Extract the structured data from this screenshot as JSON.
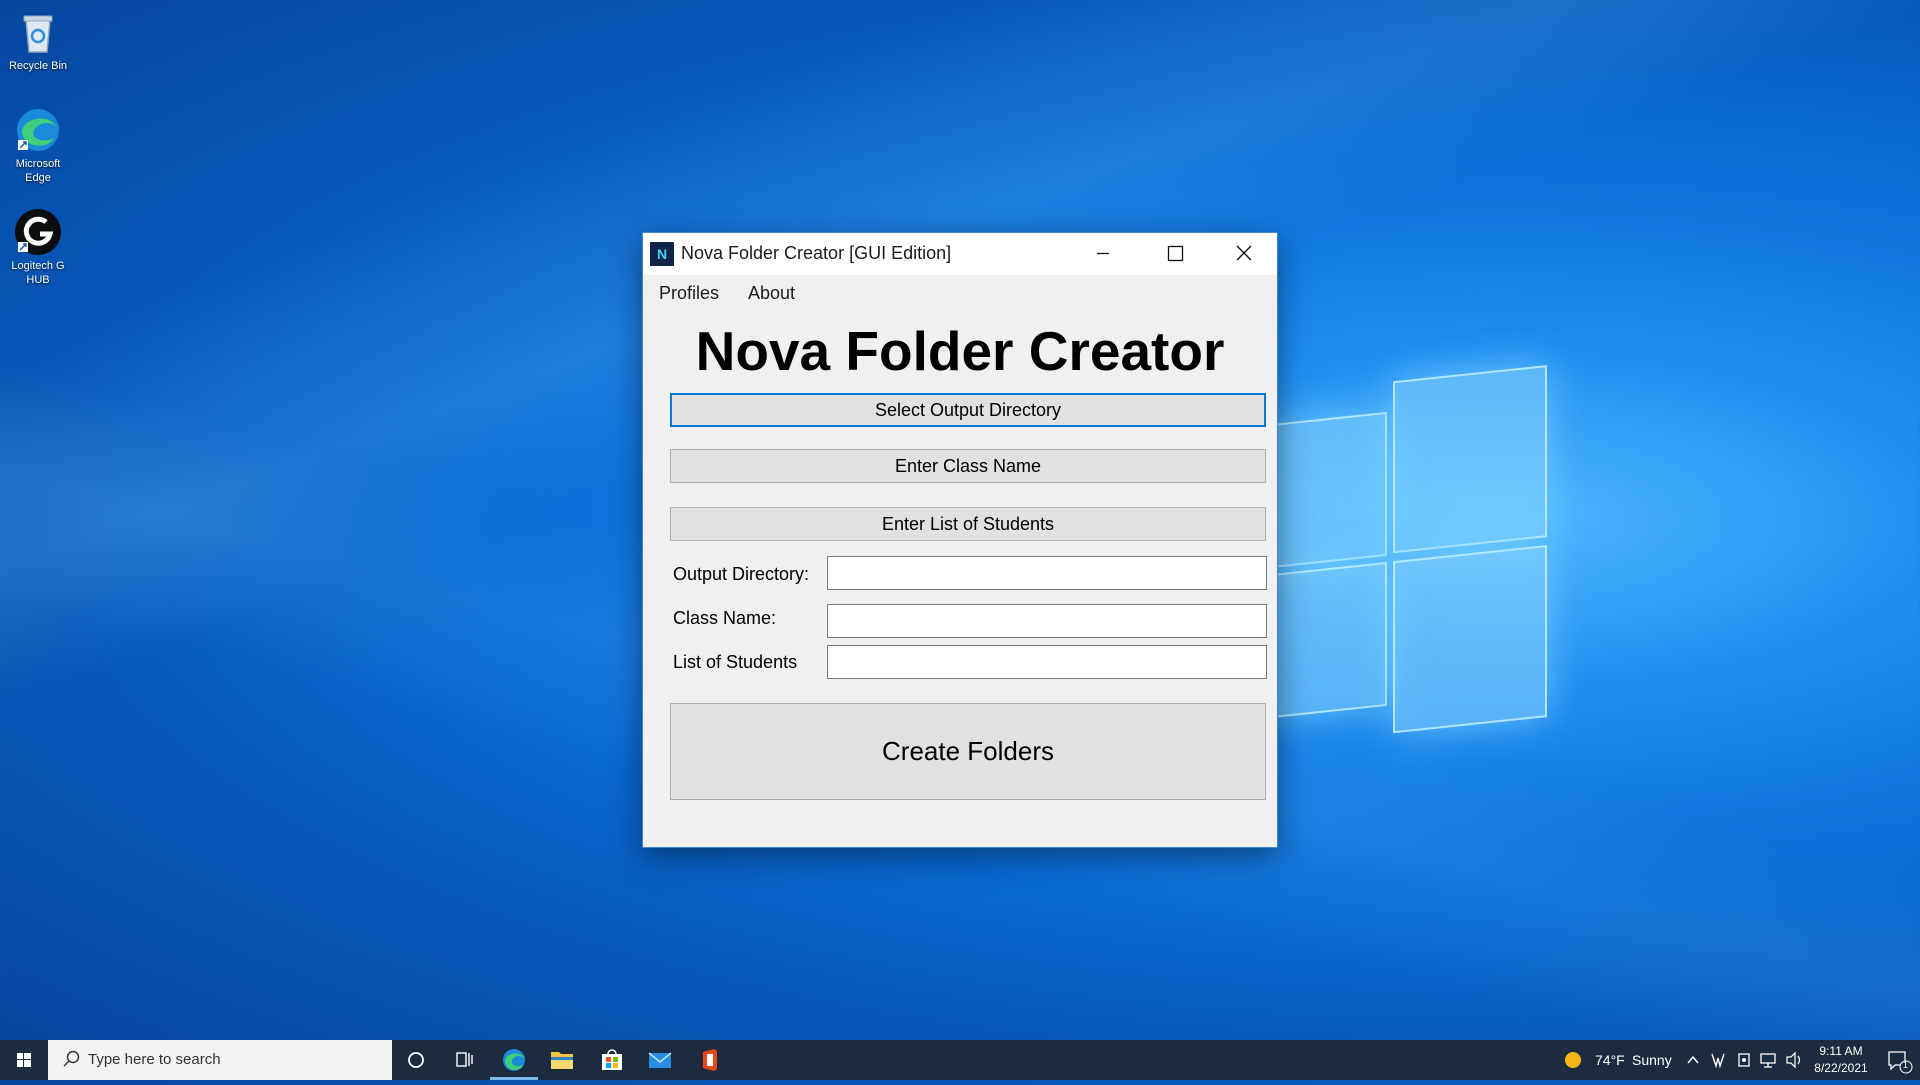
{
  "desktop": {
    "icons": [
      {
        "label": "Recycle Bin"
      },
      {
        "label": "Microsoft Edge"
      },
      {
        "label": "Logitech G HUB"
      }
    ]
  },
  "window": {
    "title": "Nova Folder Creator [GUI Edition]",
    "menu": [
      "Profiles",
      "About"
    ],
    "heading": "Nova Folder Creator",
    "buttons": {
      "select_output": "Select Output Directory",
      "enter_class": "Enter Class Name",
      "enter_students": "Enter List of Students",
      "create": "Create Folders"
    },
    "fields": [
      {
        "label": "Output Directory:",
        "value": ""
      },
      {
        "label": "Class Name:",
        "value": ""
      },
      {
        "label": "List of Students",
        "value": ""
      }
    ]
  },
  "taskbar": {
    "search_placeholder": "Type here to search",
    "weather": {
      "temp": "74°F",
      "condition": "Sunny"
    },
    "time": "9:11 AM",
    "date": "8/22/2021",
    "notification_count": "1"
  },
  "colors": {
    "accent": "#0078d7",
    "taskbar": "#1c2c3e",
    "window_bg": "#f0f0f0"
  }
}
